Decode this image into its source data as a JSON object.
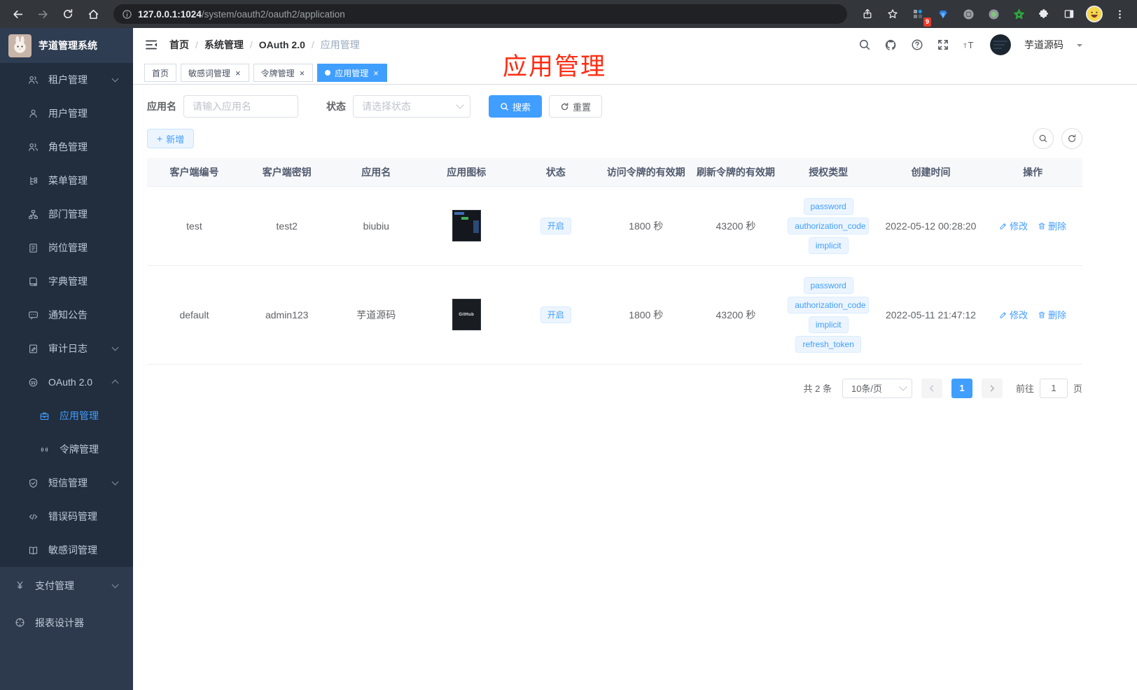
{
  "browser": {
    "url_host": "127.0.0.1:1024",
    "url_path": "/system/oauth2/oauth2/application",
    "ext_badge": "9",
    "icons": [
      "back",
      "forward",
      "reload",
      "home",
      "page-info",
      "share",
      "bookmark-star",
      "tab-grid-extension",
      "gem-extension",
      "dark-circle-extension",
      "green-dot-extension",
      "green-star-extension",
      "extensions-puzzle",
      "side-panel",
      "profile-avatar",
      "browser-menu"
    ]
  },
  "sidebar": {
    "title": "芋道管理系统",
    "logo_icon": "rabbit-logo",
    "items": [
      {
        "label": "租户管理",
        "icon": "users",
        "arrow": "down",
        "level": "sub",
        "active": false
      },
      {
        "label": "用户管理",
        "icon": "user",
        "arrow": null,
        "level": "sub",
        "active": false
      },
      {
        "label": "角色管理",
        "icon": "users",
        "arrow": null,
        "level": "sub",
        "active": false
      },
      {
        "label": "菜单管理",
        "icon": "menu-tree",
        "arrow": null,
        "level": "sub",
        "active": false
      },
      {
        "label": "部门管理",
        "icon": "org-chart",
        "arrow": null,
        "level": "sub",
        "active": false
      },
      {
        "label": "岗位管理",
        "icon": "id-badge",
        "arrow": null,
        "level": "sub",
        "active": false
      },
      {
        "label": "字典管理",
        "icon": "dictionary-book",
        "arrow": null,
        "level": "sub",
        "active": false
      },
      {
        "label": "通知公告",
        "icon": "announcement",
        "arrow": null,
        "level": "sub",
        "active": false
      },
      {
        "label": "审计日志",
        "icon": "audit-log",
        "arrow": "down",
        "level": "sub",
        "active": false
      },
      {
        "label": "OAuth 2.0",
        "icon": "oauth-robot",
        "arrow": "up",
        "level": "sub",
        "active": false
      },
      {
        "label": "应用管理",
        "icon": "app-briefcase",
        "arrow": null,
        "level": "grand",
        "active": true
      },
      {
        "label": "令牌管理",
        "icon": "token-signal",
        "arrow": null,
        "level": "grand",
        "active": false
      },
      {
        "label": "短信管理",
        "icon": "sms-shield",
        "arrow": "down",
        "level": "sub",
        "active": false
      },
      {
        "label": "错误码管理",
        "icon": "error-code",
        "arrow": null,
        "level": "sub",
        "active": false
      },
      {
        "label": "敏感词管理",
        "icon": "sensitive-words-book",
        "arrow": null,
        "level": "sub",
        "active": false
      },
      {
        "label": "支付管理",
        "icon": "pay-yen",
        "arrow": "down",
        "level": "top",
        "active": false
      },
      {
        "label": "报表设计器",
        "icon": "report-designer",
        "arrow": null,
        "level": "top",
        "active": false
      }
    ]
  },
  "header": {
    "breadcrumb": [
      "首页",
      "系统管理",
      "OAuth 2.0",
      "应用管理"
    ],
    "icons": [
      "search",
      "github",
      "help",
      "fullscreen",
      "font-size"
    ],
    "username": "芋道源码"
  },
  "tabs": [
    {
      "label": "首页",
      "closable": false,
      "active": false
    },
    {
      "label": "敏感词管理",
      "closable": true,
      "active": false
    },
    {
      "label": "令牌管理",
      "closable": true,
      "active": false
    },
    {
      "label": "应用管理",
      "closable": true,
      "active": true
    }
  ],
  "annotation": {
    "text": "应用管理",
    "color": "#ff2d12"
  },
  "filters": {
    "name_label": "应用名",
    "name_placeholder": "请输入应用名",
    "status_label": "状态",
    "status_placeholder": "请选择状态",
    "search_label": "搜索",
    "reset_label": "重置"
  },
  "toolbar": {
    "add_label": "新增"
  },
  "table": {
    "columns": [
      "客户端编号",
      "客户端密钥",
      "应用名",
      "应用图标",
      "状态",
      "访问令牌的有效期",
      "刷新令牌的有效期",
      "授权类型",
      "创建时间",
      "操作"
    ],
    "edit_label": "修改",
    "delete_label": "删除",
    "rows": [
      {
        "client_id": "test",
        "client_secret": "test2",
        "app_name": "biubiu",
        "icon": "dashboard-screenshot",
        "icon_text": "",
        "status": "开启",
        "access_token_validity": "1800 秒",
        "refresh_token_validity": "43200 秒",
        "grant_types": [
          "password",
          "authorization_code",
          "implicit"
        ],
        "created_at": "2022-05-12 00:28:20"
      },
      {
        "client_id": "default",
        "client_secret": "admin123",
        "app_name": "芋道源码",
        "icon": "github-logo",
        "icon_text": "GitHub",
        "status": "开启",
        "access_token_validity": "1800 秒",
        "refresh_token_validity": "43200 秒",
        "grant_types": [
          "password",
          "authorization_code",
          "implicit",
          "refresh_token"
        ],
        "created_at": "2022-05-11 21:47:12"
      }
    ]
  },
  "pagination": {
    "total": "共 2 条",
    "page_size": "10条/页",
    "current_page": "1",
    "goto_label": "前往",
    "goto_value": "1",
    "page_unit": "页"
  },
  "colors": {
    "accent": "#409eff",
    "tag_bg": "#ecf5ff",
    "tag_border": "#d9ecff",
    "sidebar_bg": "#2d3a4d",
    "sidebar_sub_bg": "#222d3d",
    "annotation_red": "#ff2d12"
  }
}
